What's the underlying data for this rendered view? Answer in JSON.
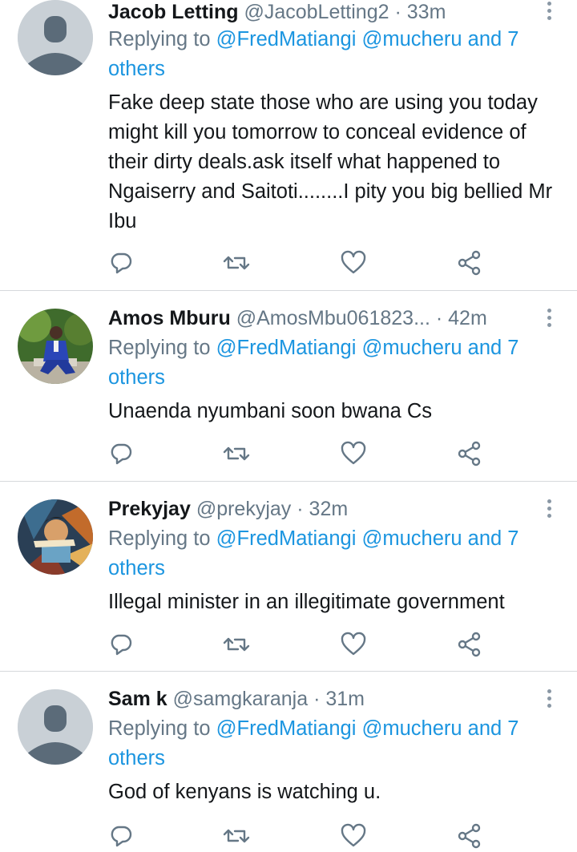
{
  "colors": {
    "link": "#1b95e0",
    "meta": "#657786",
    "text": "#14171a",
    "divider": "#d6d9dc",
    "icon": "#657786"
  },
  "tweets": [
    {
      "name": "Jacob Letting",
      "handle": "@JacobLetting2",
      "time": "· 33m",
      "reply_prefix": "Replying to",
      "mentions": "@FredMatiangi @mucheru and 7 others",
      "text": "Fake deep state those who are using you today might kill you tomorrow to conceal evidence of their dirty deals.ask itself what happened to Ngaiserry and Saitoti........I pity you big bellied Mr Ibu",
      "avatar": "default-avatar"
    },
    {
      "name": "Amos Mburu",
      "handle": "@AmosMbu061823...",
      "time": "· 42m",
      "reply_prefix": "Replying to",
      "mentions": "@FredMatiangi @mucheru and 7 others",
      "text": "Unaenda nyumbani soon bwana Cs",
      "avatar": "photo-avatar"
    },
    {
      "name": "Prekyjay",
      "handle": "@prekyjay",
      "time": "· 32m",
      "reply_prefix": "Replying to",
      "mentions": "@FredMatiangi @mucheru and 7 others",
      "text": "Illegal minister in an illegitimate government",
      "avatar": "art-avatar"
    },
    {
      "name": "Sam k",
      "handle": "@samgkaranja",
      "time": "· 31m",
      "reply_prefix": "Replying to",
      "mentions": "@FredMatiangi @mucheru and 7 others",
      "text": "God of kenyans is watching u.",
      "avatar": "default-avatar"
    }
  ],
  "action_icons": [
    "reply-icon",
    "retweet-icon",
    "like-icon",
    "share-icon"
  ]
}
